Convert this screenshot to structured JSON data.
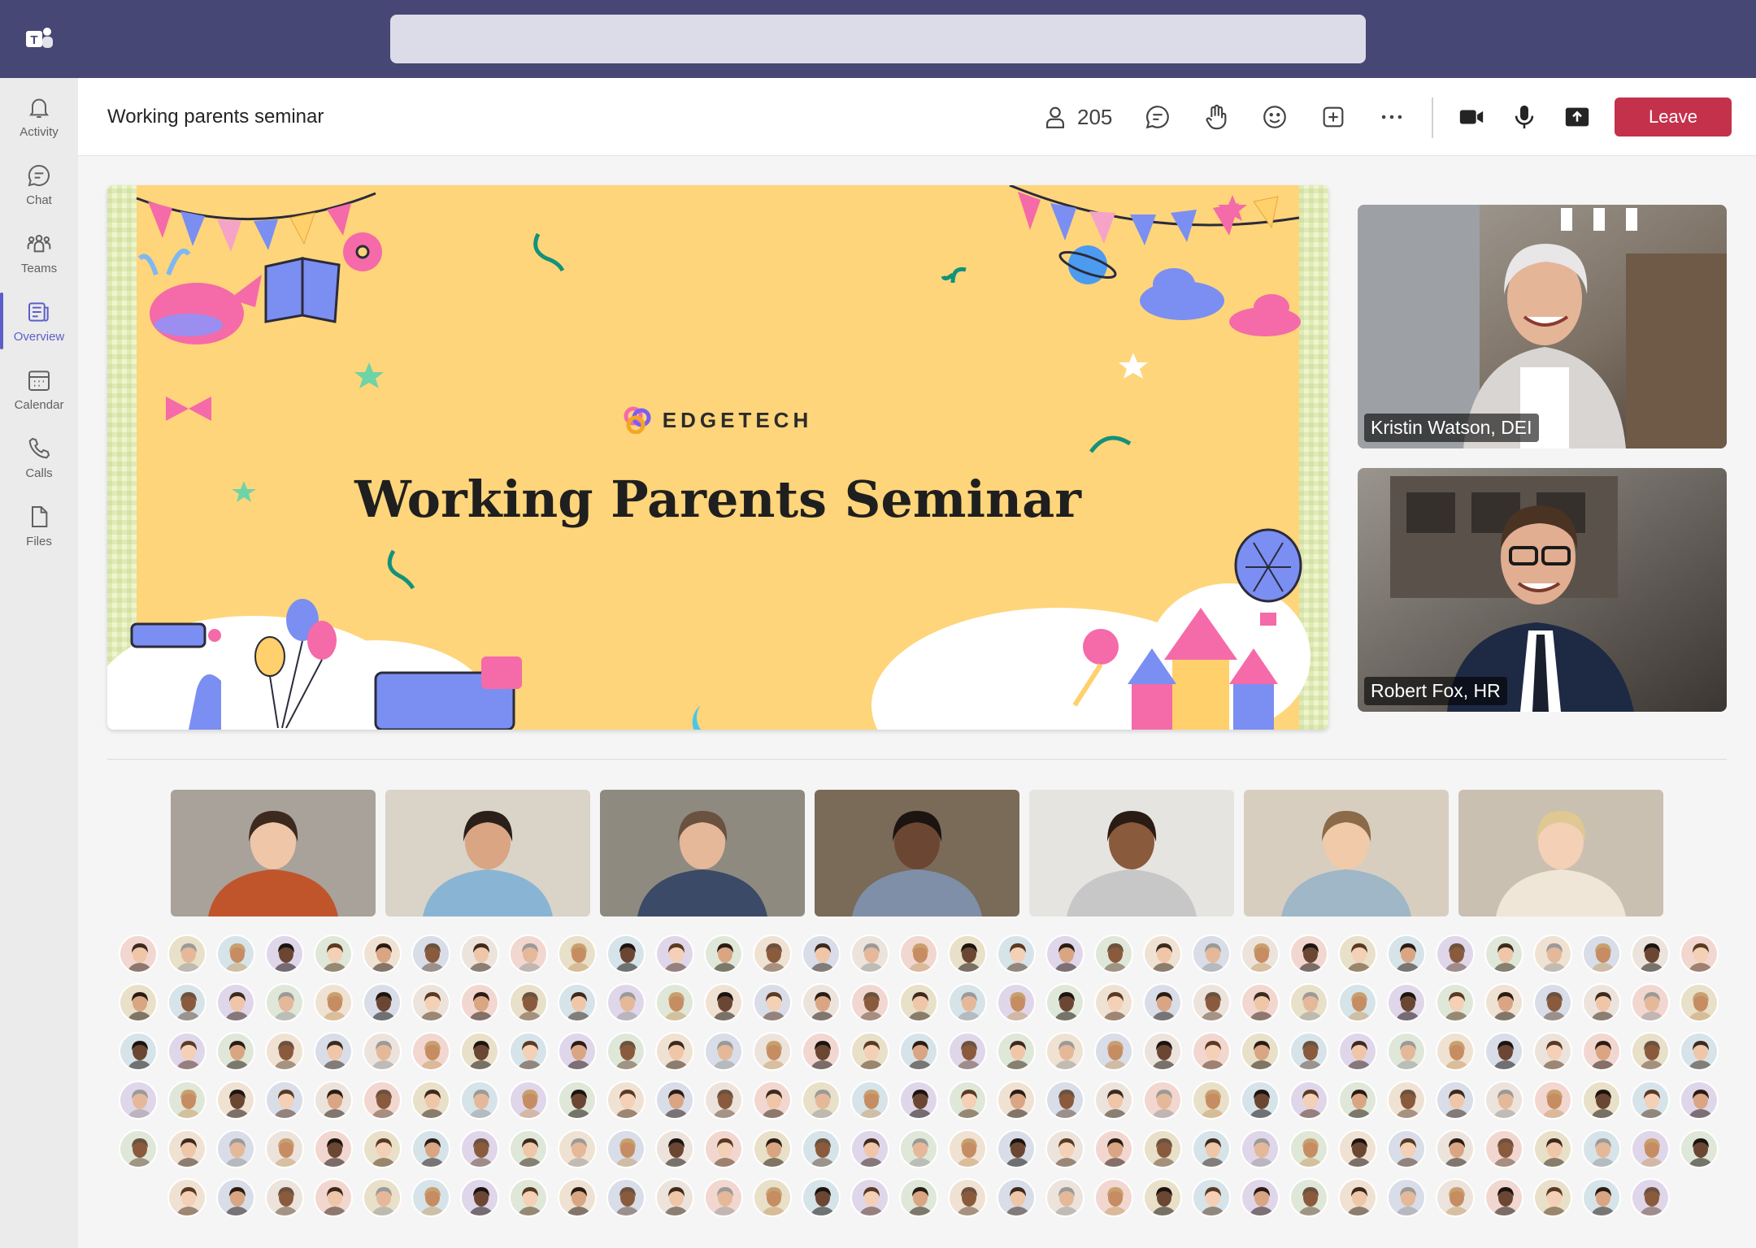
{
  "app": {
    "logo_icon": "teams-logo-icon",
    "search_placeholder": ""
  },
  "rail": {
    "items": [
      {
        "label": "Activity",
        "icon": "bell-icon"
      },
      {
        "label": "Chat",
        "icon": "chat-icon"
      },
      {
        "label": "Teams",
        "icon": "teams-icon"
      },
      {
        "label": "Overview",
        "icon": "overview-icon",
        "active": true
      },
      {
        "label": "Calendar",
        "icon": "calendar-icon"
      },
      {
        "label": "Calls",
        "icon": "phone-icon"
      },
      {
        "label": "Files",
        "icon": "file-icon"
      }
    ]
  },
  "meeting": {
    "title": "Working parents seminar",
    "participants_count": "205",
    "leave_label": "Leave"
  },
  "slide": {
    "brand": "EDGETECH",
    "title": "Working Parents Seminar"
  },
  "speakers": [
    {
      "name": "Kristin Watson, DEI"
    },
    {
      "name": "Robert Fox, HR"
    }
  ],
  "colors": {
    "topbar": "#464775",
    "accent": "#5b5fc7",
    "leave": "#c4314b",
    "slide_bg": "#fed57a"
  }
}
